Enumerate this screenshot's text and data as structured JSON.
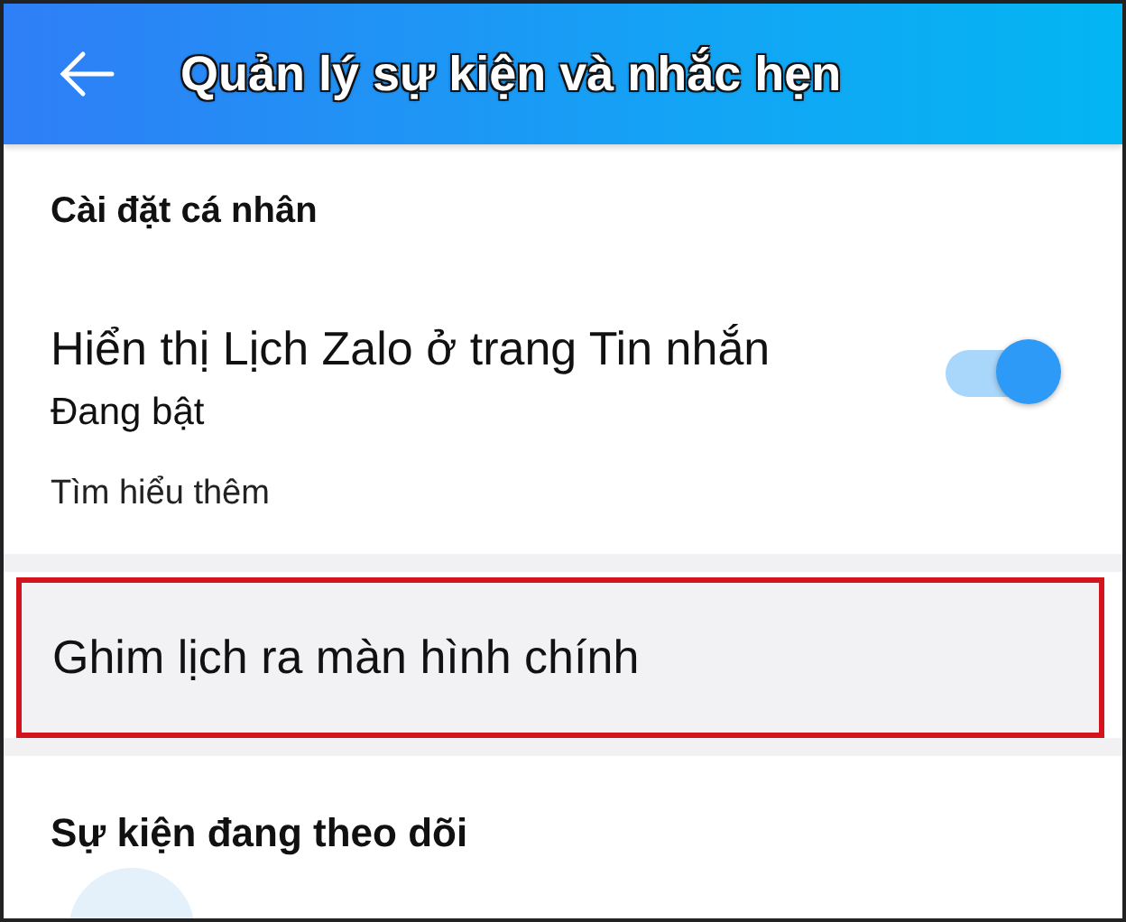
{
  "header": {
    "title": "Quản lý sự kiện và nhắc hẹn"
  },
  "sections": [
    {
      "title": "Cài đặt cá nhân",
      "items": [
        {
          "kind": "toggle",
          "label": "Hiển thị Lịch Zalo ở trang Tin nhắn",
          "status": "Đang bật",
          "on": true,
          "link": "Tìm hiểu thêm"
        },
        {
          "kind": "action",
          "label": "Ghim lịch ra màn hình chính",
          "highlighted": true
        }
      ]
    },
    {
      "title": "Sự kiện đang theo dõi",
      "items": [
        {
          "kind": "avatar"
        }
      ]
    }
  ]
}
